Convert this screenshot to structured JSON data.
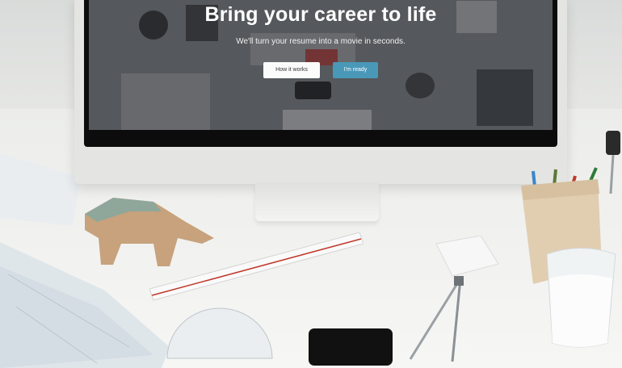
{
  "hero": {
    "title": "Bring your career to life",
    "subtitle": "We'll turn your resume into a movie in seconds.",
    "button_how": "How it works",
    "button_ready": "I'm ready"
  },
  "colors": {
    "accent": "#4a98b8",
    "secondary_button": "#fbfbfb"
  }
}
